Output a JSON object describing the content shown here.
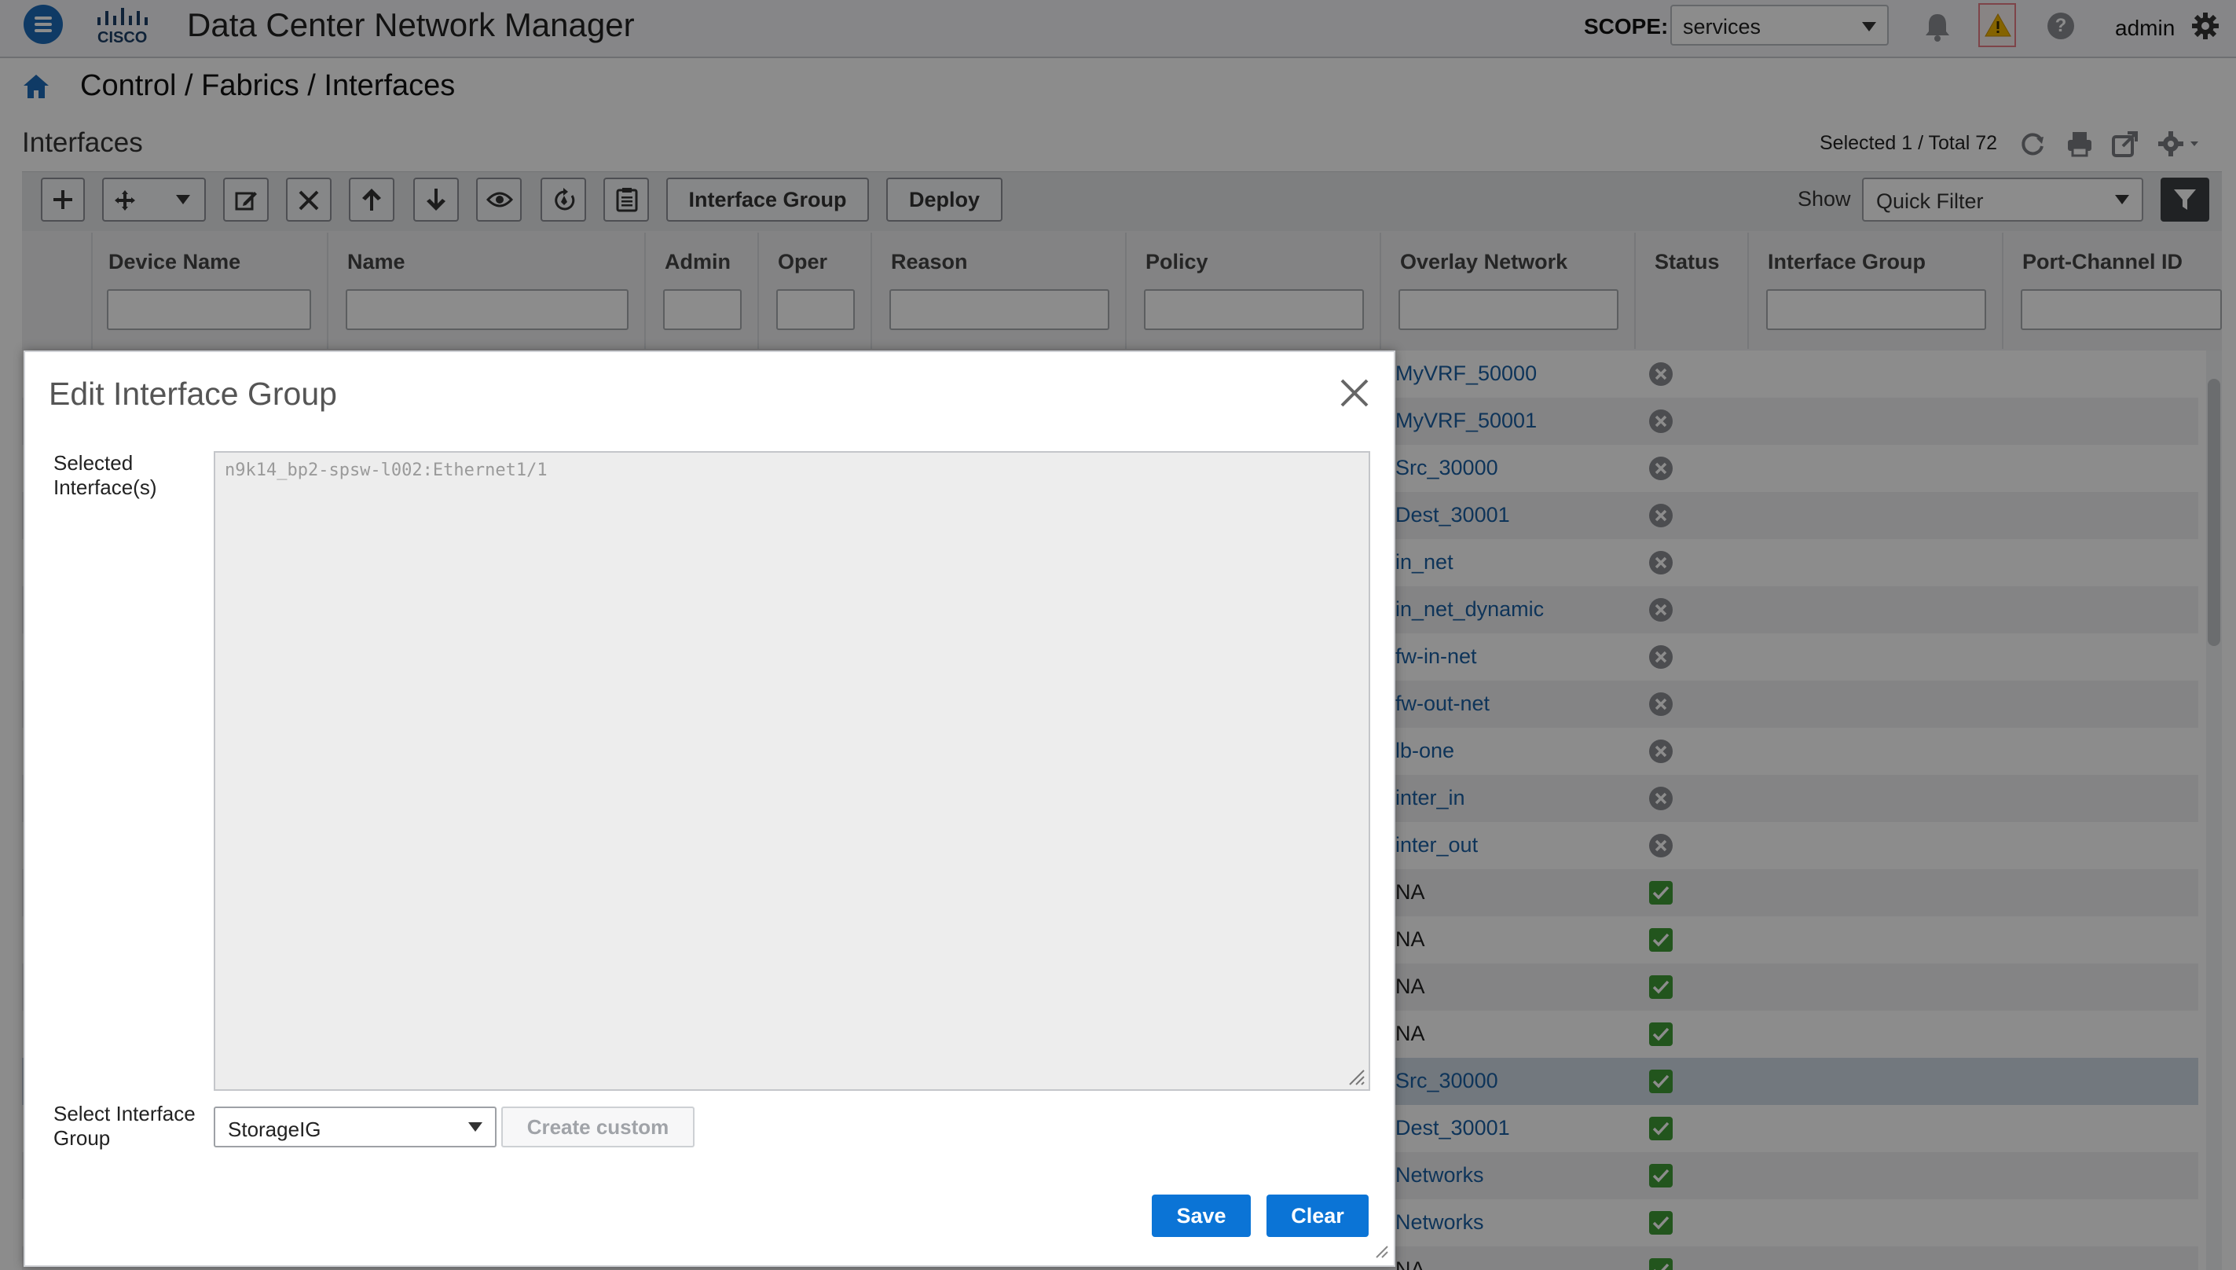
{
  "header": {
    "app_title": "Data Center Network Manager",
    "scope_label": "SCOPE:",
    "scope_value": "services",
    "user": "admin"
  },
  "breadcrumb": "Control / Fabrics / Interfaces",
  "page": {
    "title": "Interfaces",
    "selection_count": "Selected 1 / Total 72"
  },
  "toolbar": {
    "interface_group_label": "Interface Group",
    "deploy_label": "Deploy",
    "show_label": "Show",
    "quick_filter_value": "Quick Filter"
  },
  "table": {
    "columns": [
      "Device Name",
      "Name",
      "Admin",
      "Oper",
      "Reason",
      "Policy",
      "Overlay Network",
      "Status",
      "Interface Group",
      "Port-Channel ID"
    ],
    "rows": [
      {
        "overlay": "MyVRF_50000",
        "status": "error"
      },
      {
        "overlay": "MyVRF_50001",
        "status": "error"
      },
      {
        "overlay": "Src_30000",
        "status": "error"
      },
      {
        "overlay": "Dest_30001",
        "status": "error"
      },
      {
        "overlay": "in_net",
        "status": "error"
      },
      {
        "overlay": "in_net_dynamic",
        "status": "error"
      },
      {
        "overlay": "fw-in-net",
        "status": "error"
      },
      {
        "overlay": "fw-out-net",
        "status": "error"
      },
      {
        "overlay": "lb-one",
        "status": "error"
      },
      {
        "overlay": "inter_in",
        "status": "error"
      },
      {
        "overlay": "inter_out",
        "status": "error"
      },
      {
        "overlay": "NA",
        "status": "ok"
      },
      {
        "overlay": "NA",
        "status": "ok"
      },
      {
        "overlay": "NA",
        "status": "ok"
      },
      {
        "overlay": "NA",
        "status": "ok"
      },
      {
        "overlay": "Src_30000",
        "status": "ok",
        "selected": true
      },
      {
        "overlay": "Dest_30001",
        "status": "ok"
      },
      {
        "overlay": "Networks",
        "status": "ok"
      },
      {
        "overlay": "Networks",
        "status": "ok"
      },
      {
        "overlay": "NA",
        "status": "ok"
      }
    ]
  },
  "modal": {
    "title": "Edit Interface Group",
    "selected_label": "Selected Interface(s)",
    "selected_value": "n9k14_bp2-spsw-l002:Ethernet1/1",
    "group_label": "Select Interface Group",
    "group_value": "StorageIG",
    "create_custom_label": "Create custom",
    "save_label": "Save",
    "clear_label": "Clear"
  },
  "colors": {
    "primary_button": "#0b74d6",
    "link": "#1b5fa3",
    "status_ok": "#3f9c35",
    "status_error": "#8a8d93",
    "warning": "#f0b400",
    "brand": "#1d6bb8"
  }
}
